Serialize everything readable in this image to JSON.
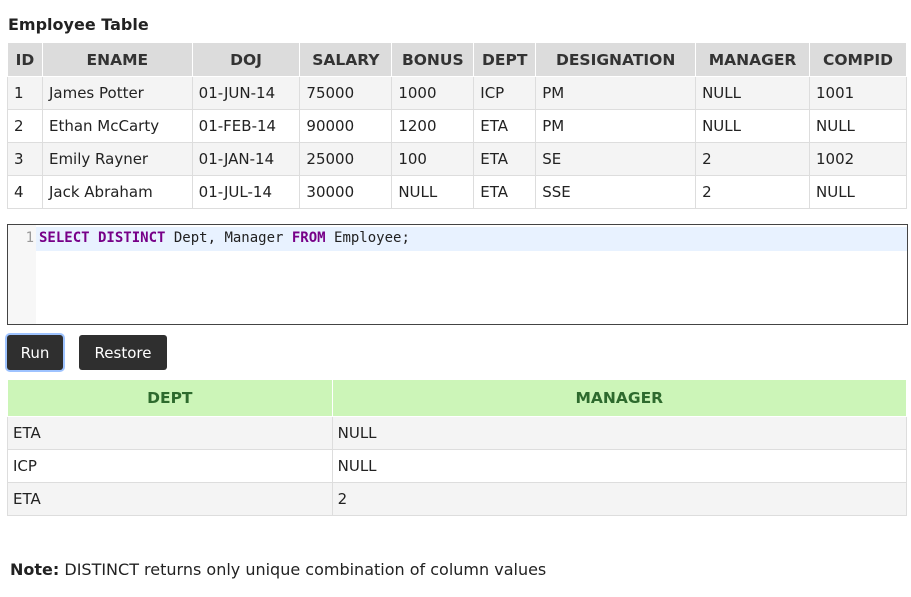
{
  "employee_table": {
    "title": "Employee Table",
    "headers": [
      "ID",
      "ENAME",
      "DOJ",
      "SALARY",
      "BONUS",
      "DEPT",
      "DESIGNATION",
      "MANAGER",
      "COMPID"
    ],
    "rows": [
      [
        "1",
        "James Potter",
        "01-JUN-14",
        "75000",
        "1000",
        "ICP",
        "PM",
        "NULL",
        "1001"
      ],
      [
        "2",
        "Ethan McCarty",
        "01-FEB-14",
        "90000",
        "1200",
        "ETA",
        "PM",
        "NULL",
        "NULL"
      ],
      [
        "3",
        "Emily Rayner",
        "01-JAN-14",
        "25000",
        "100",
        "ETA",
        "SE",
        "2",
        "1002"
      ],
      [
        "4",
        "Jack Abraham",
        "01-JUL-14",
        "30000",
        "NULL",
        "ETA",
        "SSE",
        "2",
        "NULL"
      ]
    ]
  },
  "editor": {
    "line_number": "1",
    "code_tokens": {
      "kw1": "SELECT DISTINCT",
      "t1": " Dept, Manager ",
      "kw2": "FROM",
      "t2": " Employee;"
    }
  },
  "buttons": {
    "run": "Run",
    "restore": "Restore"
  },
  "result_table": {
    "headers": [
      "DEPT",
      "MANAGER"
    ],
    "rows": [
      [
        "ETA",
        "NULL"
      ],
      [
        "ICP",
        "NULL"
      ],
      [
        "ETA",
        "2"
      ]
    ]
  },
  "note": {
    "label": "Note:",
    "text": " DISTINCT returns only unique combination of column values"
  }
}
